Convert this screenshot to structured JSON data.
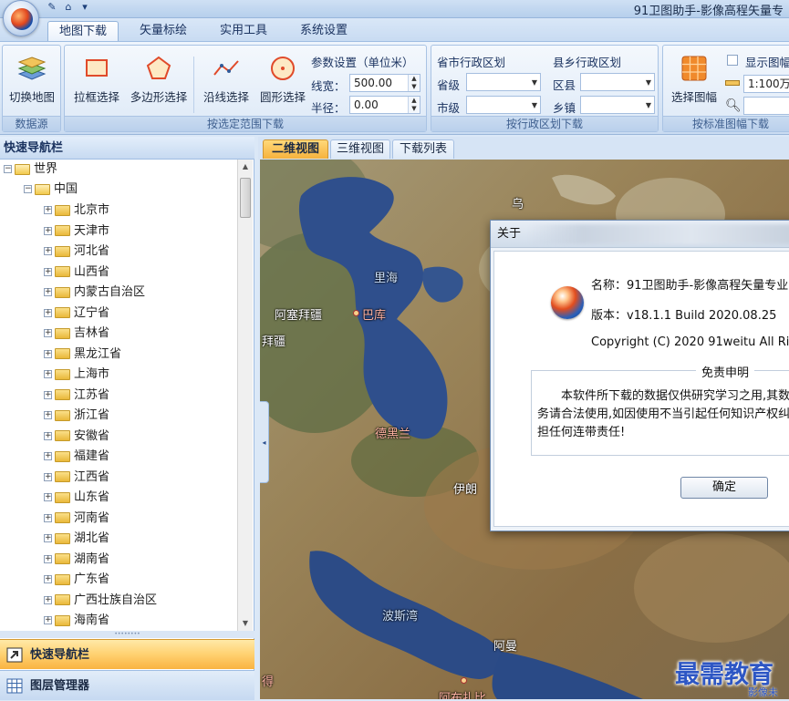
{
  "app": {
    "title": "91卫图助手-影像高程矢量专"
  },
  "ribbon_tabs": [
    "地图下载",
    "矢量标绘",
    "实用工具",
    "系统设置"
  ],
  "ribbon": {
    "data_source": {
      "switch_map": "切换地图",
      "group_label": "数据源"
    },
    "range": {
      "rect_select": "拉框选择",
      "polygon_select": "多边形选择",
      "line_select": "沿线选择",
      "circle_select": "圆形选择",
      "params_title": "参数设置（单位米）",
      "line_width_label": "线宽：",
      "line_width_value": "500.00",
      "radius_label": "半径：",
      "radius_value": "0.00",
      "group_label": "按选定范围下载"
    },
    "admin": {
      "province_city_title": "省市行政区划",
      "province_label": "省级",
      "city_label": "市级",
      "county_title": "县乡行政区划",
      "county_label": "区县",
      "town_label": "乡镇",
      "group_label": "按行政区划下载"
    },
    "sheet": {
      "select_sheet": "选择图幅",
      "show_sheet": "显示图幅",
      "scale_value": "1:100万",
      "group_label": "按标准图幅下载"
    }
  },
  "left_panel": {
    "title": "快速导航栏",
    "tree": {
      "root": "世界",
      "country": "中国",
      "provinces": [
        "北京市",
        "天津市",
        "河北省",
        "山西省",
        "内蒙古自治区",
        "辽宁省",
        "吉林省",
        "黑龙江省",
        "上海市",
        "江苏省",
        "浙江省",
        "安徽省",
        "福建省",
        "江西省",
        "山东省",
        "河南省",
        "湖北省",
        "湖南省",
        "广东省",
        "广西壮族自治区",
        "海南省"
      ]
    },
    "nav_items": [
      "快速导航栏",
      "图层管理器"
    ]
  },
  "map_tabs": [
    "二维视图",
    "三维视图",
    "下载列表"
  ],
  "map_labels": {
    "caspian_sea": "里海",
    "azerbaijan": "阿塞拜疆",
    "azerbaijan_partial": "拜疆",
    "baku": "巴库",
    "tehran": "德黑兰",
    "iran": "伊朗",
    "persian_gulf": "波斯湾",
    "oman": "阿曼",
    "uzbekistan_partial": "乌",
    "bottom_left_partial": "得",
    "bottom_city_partial": "阿布扎比"
  },
  "about_dialog": {
    "title": "关于",
    "name": "名称：91卫图助手-影像高程矢量专业",
    "version": "版本：v18.1.1 Build 2020.08.25",
    "copyright": "Copyright (C) 2020  91weitu All Rig",
    "disclaimer_title": "免责申明",
    "disclaimer_lines": [
      "　　本软件所下载的数据仅供研究学习之用,其数",
      "务请合法使用,如因使用不当引起任何知识产权纠",
      "担任何连带责任!"
    ],
    "ok_button": "确定"
  },
  "watermark": {
    "main": "最需教育",
    "sub": "影像未"
  }
}
